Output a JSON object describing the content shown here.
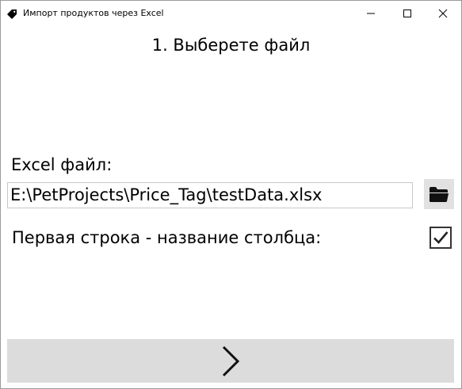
{
  "window": {
    "title": "Импорт продуктов через Excel",
    "icon": "tag-icon"
  },
  "step": {
    "title": "1. Выберете файл"
  },
  "file": {
    "label": "Excel файл:",
    "path_value": "E:\\PetProjects\\Price_Tag\\testData.xlsx",
    "browse_icon": "folder-icon"
  },
  "options": {
    "first_row_header_label": "Первая строка - название столбца:",
    "first_row_header_checked": true
  },
  "navigation": {
    "next_icon": "chevron-right-icon"
  }
}
